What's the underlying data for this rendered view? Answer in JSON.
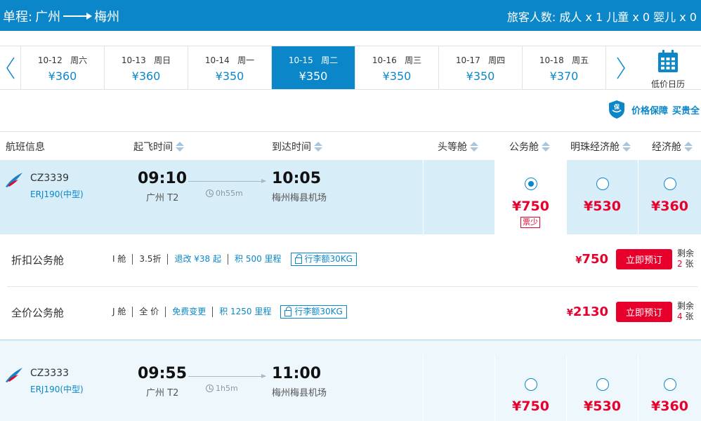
{
  "header": {
    "trip_label": "单程:",
    "from": "广州",
    "to": "梅州",
    "passengers": "旅客人数: 成人 x 1 儿童 x 0 婴儿 x 0"
  },
  "dates": [
    {
      "date": "10-12",
      "weekday": "周六",
      "price": "¥360"
    },
    {
      "date": "10-13",
      "weekday": "周日",
      "price": "¥360"
    },
    {
      "date": "10-14",
      "weekday": "周一",
      "price": "¥350"
    },
    {
      "date": "10-15",
      "weekday": "周二",
      "price": "¥350"
    },
    {
      "date": "10-16",
      "weekday": "周三",
      "price": "¥350"
    },
    {
      "date": "10-17",
      "weekday": "周四",
      "price": "¥350"
    },
    {
      "date": "10-18",
      "weekday": "周五",
      "price": "¥370"
    }
  ],
  "selected_date_index": 3,
  "calendar_label": "低价日历",
  "guarantee": {
    "label1": "价格保障",
    "label2": "买贵全"
  },
  "columns": {
    "flight": "航班信息",
    "depart": "起飞时间",
    "arrive": "到达时间",
    "first": "头等舱",
    "business": "公务舱",
    "pearl": "明珠经济舱",
    "economy": "经济舱"
  },
  "flights": [
    {
      "number": "CZ3339",
      "aircraft": "ERJ190(中型)",
      "dep_time": "09:10",
      "dep_airport": "广州 T2",
      "duration": "0h55m",
      "arr_time": "10:05",
      "arr_airport": "梅州梅县机场",
      "business_price": "¥750",
      "business_tag": "票少",
      "pearl_price": "¥530",
      "economy_price": "¥360"
    },
    {
      "number": "CZ3333",
      "aircraft": "ERJ190(中型)",
      "dep_time": "09:55",
      "dep_airport": "广州 T2",
      "duration": "1h5m",
      "arr_time": "11:00",
      "arr_airport": "梅州梅县机场",
      "business_price": "¥750",
      "pearl_price": "¥530",
      "economy_price": "¥360"
    }
  ],
  "fares": [
    {
      "name": "折扣公务舱",
      "cabin": "I 舱",
      "discount": "3.5折",
      "change": "退改 ¥38 起",
      "miles": "积 500 里程",
      "baggage": "行李额30KG",
      "yen": "¥",
      "price": "750",
      "book": "立即预订",
      "remain_label": "剩余",
      "remain_count": "2",
      "remain_unit": "张"
    },
    {
      "name": "全价公务舱",
      "cabin": "J 舱",
      "discount": "全 价",
      "change": "免费变更",
      "miles": "积 1250 里程",
      "baggage": "行李额30KG",
      "yen": "¥",
      "price": "2130",
      "book": "立即预订",
      "remain_label": "剩余",
      "remain_count": "4",
      "remain_unit": "张"
    }
  ],
  "colors": {
    "brand": "#0b87c9",
    "price": "#e8002c",
    "row_highlight": "#d7edf8"
  },
  "icons": [
    "chevron-left-icon",
    "chevron-right-icon",
    "calendar-icon",
    "shield-icon",
    "airline-logo-icon",
    "clock-icon",
    "luggage-icon"
  ]
}
